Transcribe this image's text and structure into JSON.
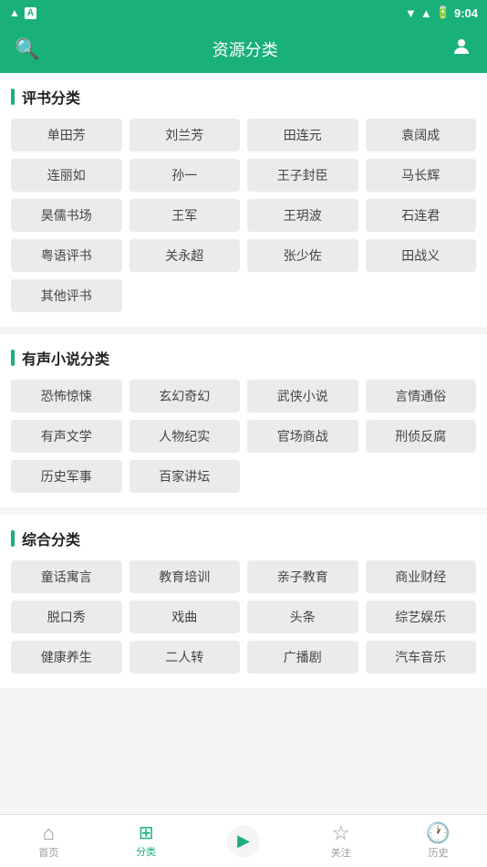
{
  "statusBar": {
    "time": "9:04",
    "battery": "🔋",
    "signal": "▲"
  },
  "topBar": {
    "title": "资源分类",
    "searchIcon": "🔍",
    "userIcon": "👤"
  },
  "sections": [
    {
      "id": "pingbook",
      "title": "评书分类",
      "tags": [
        "单田芳",
        "刘兰芳",
        "田连元",
        "袁阔成",
        "连丽如",
        "孙一",
        "王子封臣",
        "马长辉",
        "昊儒书场",
        "王军",
        "王玥波",
        "石连君",
        "粤语评书",
        "关永超",
        "张少佐",
        "田战义",
        "其他评书"
      ]
    },
    {
      "id": "audionovel",
      "title": "有声小说分类",
      "tags": [
        "恐怖惊悚",
        "玄幻奇幻",
        "武侠小说",
        "言情通俗",
        "有声文学",
        "人物纪实",
        "官场商战",
        "刑侦反腐",
        "历史军事",
        "百家讲坛"
      ]
    },
    {
      "id": "comprehensive",
      "title": "综合分类",
      "tags": [
        "童话寓言",
        "教育培训",
        "亲子教育",
        "商业财经",
        "脱口秀",
        "戏曲",
        "头条",
        "综艺娱乐",
        "健康养生",
        "二人转",
        "广播剧",
        "汽车音乐"
      ]
    }
  ],
  "bottomNav": [
    {
      "id": "home",
      "label": "首页",
      "icon": "🏠",
      "active": false
    },
    {
      "id": "category",
      "label": "分类",
      "icon": "⊞",
      "active": true
    },
    {
      "id": "play",
      "label": "",
      "icon": "▶",
      "active": false
    },
    {
      "id": "follow",
      "label": "关注",
      "icon": "☆",
      "active": false
    },
    {
      "id": "history",
      "label": "历史",
      "icon": "🕐",
      "active": false
    }
  ]
}
